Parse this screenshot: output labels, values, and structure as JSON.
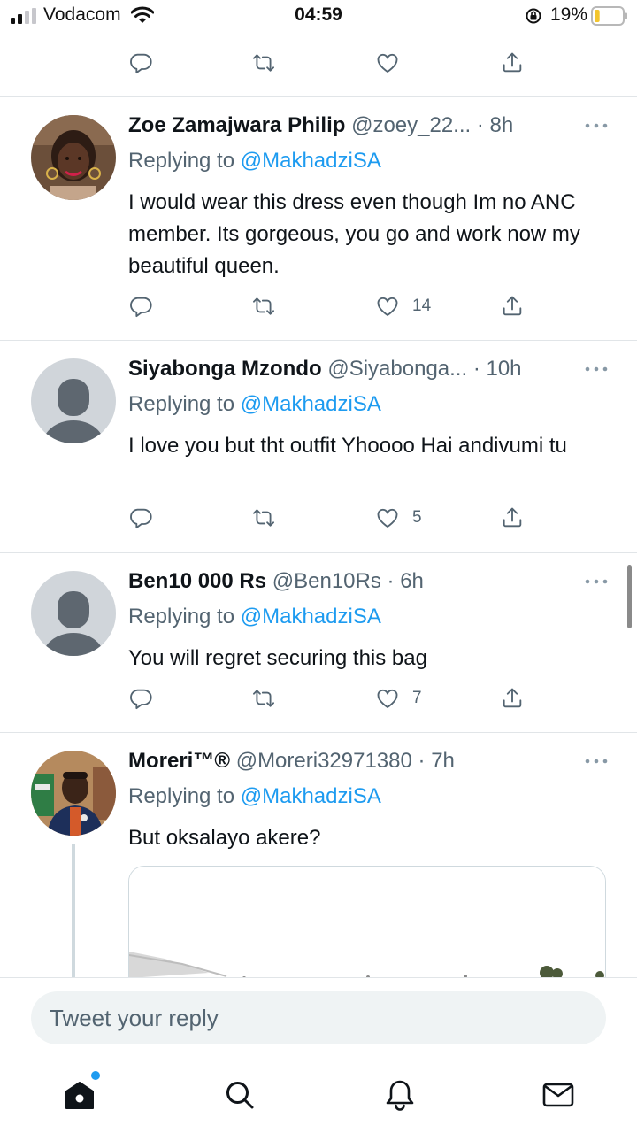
{
  "status_bar": {
    "carrier": "Vodacom",
    "time": "04:59",
    "battery_percent": "19%",
    "battery_level": 0.19
  },
  "top_action_bar": {
    "icons": [
      "reply-icon",
      "retweet-icon",
      "like-icon",
      "share-icon"
    ]
  },
  "tweets": [
    {
      "name": "Zoe Zamajwara Philip",
      "handle": "@zoey_22...",
      "time": "· 8h",
      "replying_prefix": "Replying to ",
      "replying_to": "@MakhadziSA",
      "text": "I would wear this dress even though Im no ANC member. Its gorgeous, you go and work now my beautiful queen.",
      "likes": "14"
    },
    {
      "name": "Siyabonga Mzondo",
      "handle": "@Siyabonga...",
      "time": "· 10h",
      "replying_prefix": "Replying to ",
      "replying_to": "@MakhadziSA",
      "text": "I love you but tht outfit Yhoooo Hai andivumi tu",
      "likes": "5"
    },
    {
      "name": "Ben10 000 Rs",
      "handle": "@Ben10Rs",
      "time": "· 6h",
      "replying_prefix": "Replying to ",
      "replying_to": "@MakhadziSA",
      "text": "You will regret securing this bag",
      "likes": "7"
    },
    {
      "name": "Moreri™®",
      "handle": "@Moreri32971380",
      "time": "· 7h",
      "replying_prefix": "Replying to ",
      "replying_to": "@MakhadziSA",
      "text": "But oksalayo akere?"
    }
  ],
  "reply_box": {
    "placeholder": "Tweet your reply"
  },
  "tab_bar": {
    "tabs": [
      "home-icon",
      "search-icon",
      "notifications-icon",
      "messages-icon"
    ],
    "home_has_new": true
  },
  "colors": {
    "accent": "#1d9bf0",
    "secondary_text": "#536471",
    "primary_text": "#0f1419"
  }
}
